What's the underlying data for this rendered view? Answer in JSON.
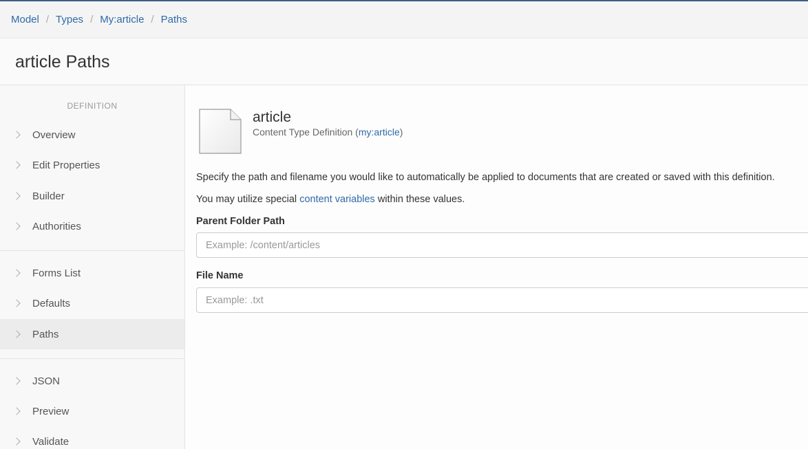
{
  "breadcrumb": {
    "items": [
      "Model",
      "Types",
      "My:article",
      "Paths"
    ],
    "separator": "/"
  },
  "page": {
    "title": "article Paths"
  },
  "sidebar": {
    "heading": "DEFINITION",
    "items": [
      {
        "label": "Overview"
      },
      {
        "label": "Edit Properties"
      },
      {
        "label": "Builder"
      },
      {
        "label": "Authorities"
      },
      {
        "label": "Forms List"
      },
      {
        "label": "Defaults"
      },
      {
        "label": "Paths",
        "active": true
      },
      {
        "label": "JSON"
      },
      {
        "label": "Preview"
      },
      {
        "label": "Validate"
      }
    ]
  },
  "entity": {
    "icon": "document-icon",
    "title": "article",
    "subtitle_prefix": "Content Type Definition (",
    "subtitle_link": "my:article",
    "subtitle_suffix": ")"
  },
  "description": {
    "line1": "Specify the path and filename you would like to automatically be applied to documents that are created or saved with this definition.",
    "line2_prefix": "You may utilize special ",
    "line2_link": "content variables",
    "line2_suffix": " within these values."
  },
  "form": {
    "parent_folder": {
      "label": "Parent Folder Path",
      "value": "",
      "placeholder": "Example: /content/articles"
    },
    "file_name": {
      "label": "File Name",
      "value": "",
      "placeholder": "Example: .txt"
    }
  },
  "colors": {
    "link": "#2f6aa8",
    "accent_bar": "#3b5f8a"
  }
}
